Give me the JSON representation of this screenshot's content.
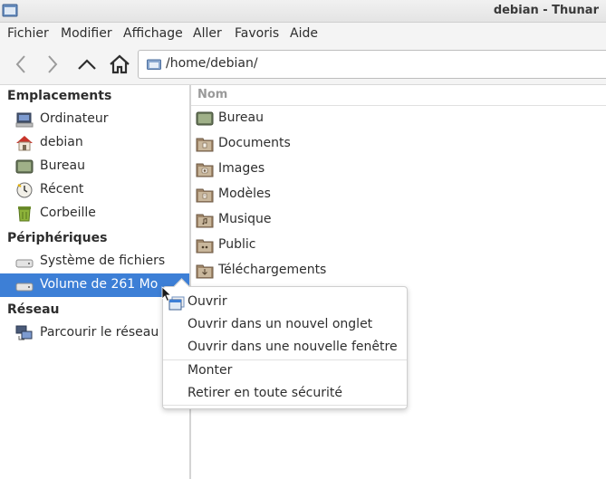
{
  "window": {
    "title": "debian - Thunar",
    "app_icon": "folder-window-icon"
  },
  "menubar": {
    "items": [
      "Fichier",
      "Modifier",
      "Affichage",
      "Aller",
      "Favoris",
      "Aide"
    ]
  },
  "toolbar": {
    "back_icon": "chevron-left-icon",
    "forward_icon": "chevron-right-icon",
    "up_icon": "chevron-up-icon",
    "home_icon": "home-icon",
    "path": "/home/debian/"
  },
  "sidebar": {
    "sections": [
      {
        "title": "Emplacements",
        "items": [
          {
            "label": "Ordinateur",
            "icon": "computer-icon"
          },
          {
            "label": "debian",
            "icon": "home-icon"
          },
          {
            "label": "Bureau",
            "icon": "desktop-icon"
          },
          {
            "label": "Récent",
            "icon": "recent-clock-icon"
          },
          {
            "label": "Corbeille",
            "icon": "trash-icon"
          }
        ]
      },
      {
        "title": "Périphériques",
        "items": [
          {
            "label": "Système de fichiers",
            "icon": "drive-icon"
          },
          {
            "label": "Volume de 261 Mo",
            "icon": "drive-icon",
            "selected": true
          }
        ]
      },
      {
        "title": "Réseau",
        "items": [
          {
            "label": "Parcourir le réseau",
            "icon": "network-icon"
          }
        ]
      }
    ]
  },
  "files": {
    "column_header": "Nom",
    "items": [
      {
        "name": "Bureau",
        "icon": "desktop-folder-icon"
      },
      {
        "name": "Documents",
        "icon": "documents-folder-icon"
      },
      {
        "name": "Images",
        "icon": "pictures-folder-icon"
      },
      {
        "name": "Modèles",
        "icon": "templates-folder-icon"
      },
      {
        "name": "Musique",
        "icon": "music-folder-icon"
      },
      {
        "name": "Public",
        "icon": "public-folder-icon"
      },
      {
        "name": "Téléchargements",
        "icon": "downloads-folder-icon"
      }
    ]
  },
  "context_menu": {
    "items": [
      "Ouvrir",
      "Ouvrir dans un nouvel onglet",
      "Ouvrir dans une nouvelle fenêtre",
      "Monter",
      "Retirer en toute sécurité"
    ],
    "open_icon": "open-window-icon"
  },
  "colors": {
    "selection": "#3d7fd6",
    "folder": "#a0876a"
  }
}
